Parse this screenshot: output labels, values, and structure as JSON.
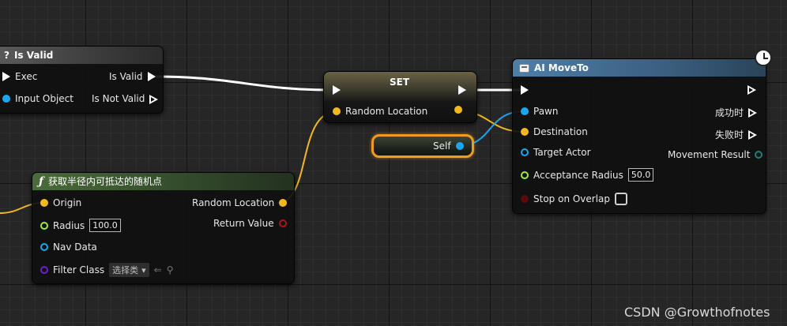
{
  "colors": {
    "exec": "#ffffff",
    "vector": "#f2b81f",
    "object": "#1aa6f0",
    "float": "#9bed3a",
    "bool": "#8b0e0e",
    "class": "#6a1fd6",
    "struct": "#1f7f79",
    "selection": "#f09a1e"
  },
  "is_valid_node": {
    "title": "Is Valid",
    "icon": "question-icon",
    "inputs": {
      "exec": "Exec",
      "input_object": "Input Object"
    },
    "outputs": {
      "is_valid": "Is Valid",
      "is_not_valid": "Is Not Valid"
    }
  },
  "set_node": {
    "title": "SET",
    "input_label": "Random Location"
  },
  "self_node": {
    "label": "Self"
  },
  "random_point_node": {
    "title": "获取半径内可抵达的随机点",
    "icon": "function-icon",
    "inputs": {
      "origin": "Origin",
      "radius": "Radius",
      "radius_value": "100.0",
      "nav_data": "Nav Data",
      "filter_class": "Filter Class",
      "filter_class_select": "选择类"
    },
    "outputs": {
      "random_location": "Random Location",
      "return_value": "Return Value"
    }
  },
  "ai_moveto_node": {
    "title": "AI MoveTo",
    "latent_icon": "clock-icon",
    "inputs": {
      "pawn": "Pawn",
      "destination": "Destination",
      "target_actor": "Target Actor",
      "acceptance_radius": "Acceptance Radius",
      "acceptance_radius_value": "50.0",
      "stop_on_overlap": "Stop on Overlap"
    },
    "outputs": {
      "on_success": "成功时",
      "on_fail": "失败时",
      "movement_result": "Movement Result"
    }
  },
  "watermark": "CSDN @Growthofnotes"
}
